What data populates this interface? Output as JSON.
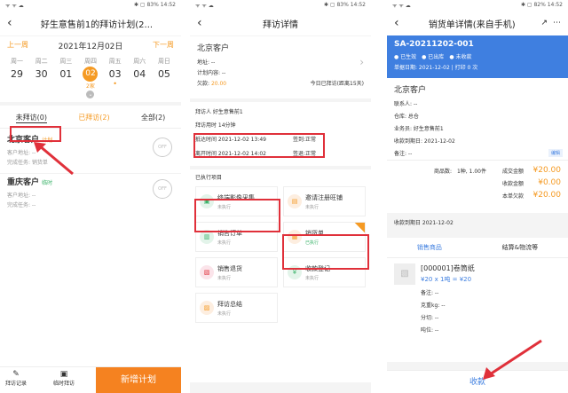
{
  "p1": {
    "status_left": "ᯤ ᯤ ☁",
    "status_right": "✱ ▢ 83% 14:52",
    "title": "好生意售前1的拜访计划(2...",
    "prev": "上一周",
    "date": "2021年12月02日",
    "next": "下一周",
    "days": [
      {
        "dow": "周一",
        "num": "29"
      },
      {
        "dow": "周二",
        "num": "30"
      },
      {
        "dow": "周三",
        "num": "01"
      },
      {
        "dow": "周四",
        "num": "02"
      },
      {
        "dow": "周五",
        "num": "03"
      },
      {
        "dow": "周六",
        "num": "04"
      },
      {
        "dow": "周日",
        "num": "05"
      }
    ],
    "today_count": "2家",
    "tabs": [
      "未拜访(0)",
      "已拜访(2)",
      "全部(2)"
    ],
    "c1_name": "北京客户",
    "c1_tag": "计划",
    "c1_addr": "客户地址:  --",
    "c1_task": "完成任务: 销货单",
    "c2_name": "重庆客户",
    "c2_tag": "临时",
    "c2_addr": "客户地址:  --",
    "c2_task": "完成任务: --",
    "stamp": "OFF",
    "bottom": [
      "拜访记录",
      "临时拜访"
    ],
    "new_plan": "新增计划"
  },
  "p2": {
    "status_left": "ᯤ ᯤ ☁",
    "status_right": "✱ ▢ 83% 14:52",
    "title": "拜访详情",
    "cust": "北京客户",
    "addr": "地址:  --",
    "plan": "计划内容:  --",
    "owe_label": "欠款: ",
    "owe": "20.00",
    "visit_note": "今日已拜访(距离15天)",
    "visitor": "拜访人    好生意售前1",
    "dur": "拜访用时   14分钟",
    "arr": "抵达时间   2021-12-02 13:49",
    "arr_sign": "签到:正常",
    "leave": "离开时间   2021-12-02 14:02",
    "leave_sign": "签退:正常",
    "exec_title": "已执行项目",
    "items": [
      {
        "name": "终端影像采集",
        "st": "未执行"
      },
      {
        "name": "邀请注册旺铺",
        "st": "未执行"
      },
      {
        "name": "销售订单",
        "st": "未执行"
      },
      {
        "name": "销货单",
        "st": "已执行"
      },
      {
        "name": "销售退货",
        "st": "未执行"
      },
      {
        "name": "收款登记",
        "st": "未执行"
      },
      {
        "name": "拜访总结",
        "st": "未执行"
      }
    ]
  },
  "p3": {
    "status_left": "ᯤ ᯤ ☁",
    "status_right": "✱ ▢ 82% 14:52",
    "title": "销货单详情(来自手机)",
    "doc_no": "SA-20211202-001",
    "badges": [
      "● 已生效",
      "● 已出库",
      "● 未收款"
    ],
    "doc_date": "单据日期: 2021-12-02 | 打印 0 次",
    "cust": "北京客户",
    "fields": [
      "联系人:  --",
      "仓库:  总仓",
      "业务员:  好生意售前1",
      "收款到期日:  2021-12-02",
      "备注:  --"
    ],
    "edit": "编辑",
    "goods": "商品数:",
    "goods_v": "1种, 1.00件",
    "amt_l": [
      "成交金额",
      "收款金额",
      "本单欠款"
    ],
    "amt_v": [
      "¥20.00",
      "¥0.00",
      "¥20.00"
    ],
    "due": "收款到期日 2021-12-02",
    "tabs": [
      "销售商品",
      "结算&物流等"
    ],
    "prod": "[000001]卷筒纸",
    "price": "¥20 x 1吨 = ¥20",
    "pfields": [
      "备注:  --",
      "克重kg:  --",
      "分切:  --",
      "吨位:  --"
    ],
    "collect": "收款"
  }
}
